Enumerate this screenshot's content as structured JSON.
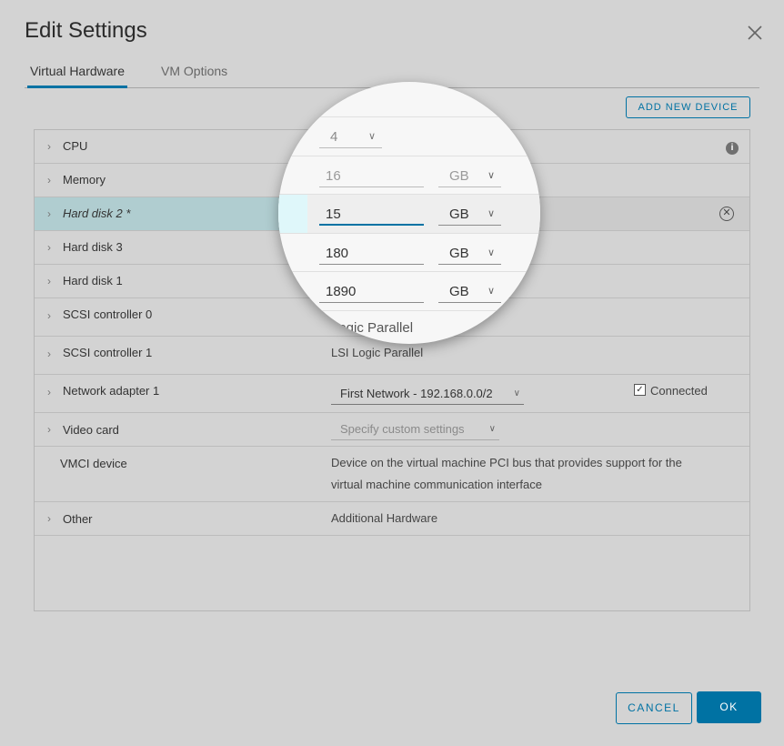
{
  "dialog": {
    "title": "Edit Settings",
    "tabs": [
      {
        "label": "Virtual Hardware",
        "active": true
      },
      {
        "label": "VM Options",
        "active": false
      }
    ],
    "add_device_label": "ADD NEW DEVICE",
    "cancel_label": "CANCEL",
    "ok_label": "OK"
  },
  "hardware": {
    "cpu": {
      "label": "CPU"
    },
    "memory": {
      "label": "Memory"
    },
    "hard_disk_2": {
      "label": "Hard disk 2 *"
    },
    "hard_disk_3": {
      "label": "Hard disk 3"
    },
    "hard_disk_1": {
      "label": "Hard disk 1"
    },
    "scsi0": {
      "label": "SCSI controller 0"
    },
    "scsi1": {
      "label": "SCSI controller 1",
      "value": "LSI Logic Parallel"
    },
    "network": {
      "label": "Network adapter 1",
      "value": "First Network - 192.168.0.0/2",
      "connected_label": "Connected",
      "connected": true
    },
    "video": {
      "label": "Video card",
      "value": "Specify custom settings"
    },
    "vmci": {
      "label": "VMCI device",
      "line1": "Device on the virtual machine PCI bus that provides support for the",
      "line2": "virtual machine communication interface"
    },
    "other": {
      "label": "Other",
      "value": "Additional Hardware"
    }
  },
  "magnifier": {
    "cpu_value": "4",
    "memory_value": "16",
    "memory_unit": "GB",
    "disk2_value": "15",
    "disk2_unit": "GB",
    "disk3_value": "180",
    "disk3_unit": "GB",
    "disk1_value": "1890",
    "disk1_unit": "GB",
    "scsi0_partial": "Logic Parallel"
  },
  "colors": {
    "accent": "#0072a3",
    "highlight_row": "#b0cdd0",
    "background": "#d3d3d3"
  }
}
